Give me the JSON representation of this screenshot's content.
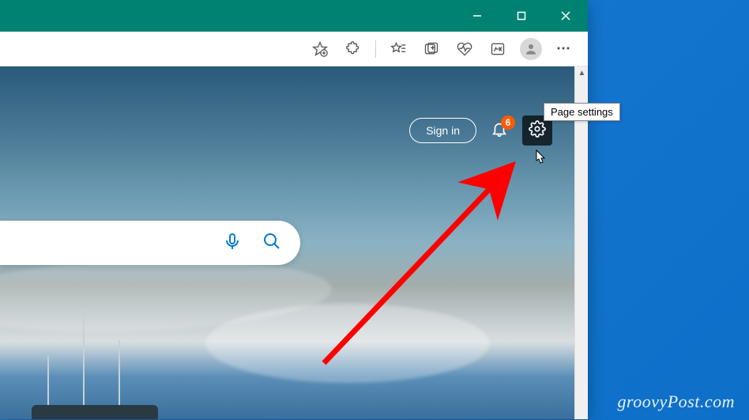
{
  "window_controls": {
    "minimize": "minimize",
    "maximize": "maximize",
    "close": "close"
  },
  "toolbar": {
    "favorite": "star-plus-icon",
    "extensions": "puzzle-icon",
    "favorites": "star-lines-icon",
    "collections": "collections-icon",
    "performance": "heartbeat-icon",
    "math": "math-icon",
    "profile": "profile-icon",
    "more": "⋯"
  },
  "ntp": {
    "sign_in_label": "Sign in",
    "notification_count": "6",
    "tooltip_text": "Page settings"
  },
  "watermark": "groovyPost.com"
}
